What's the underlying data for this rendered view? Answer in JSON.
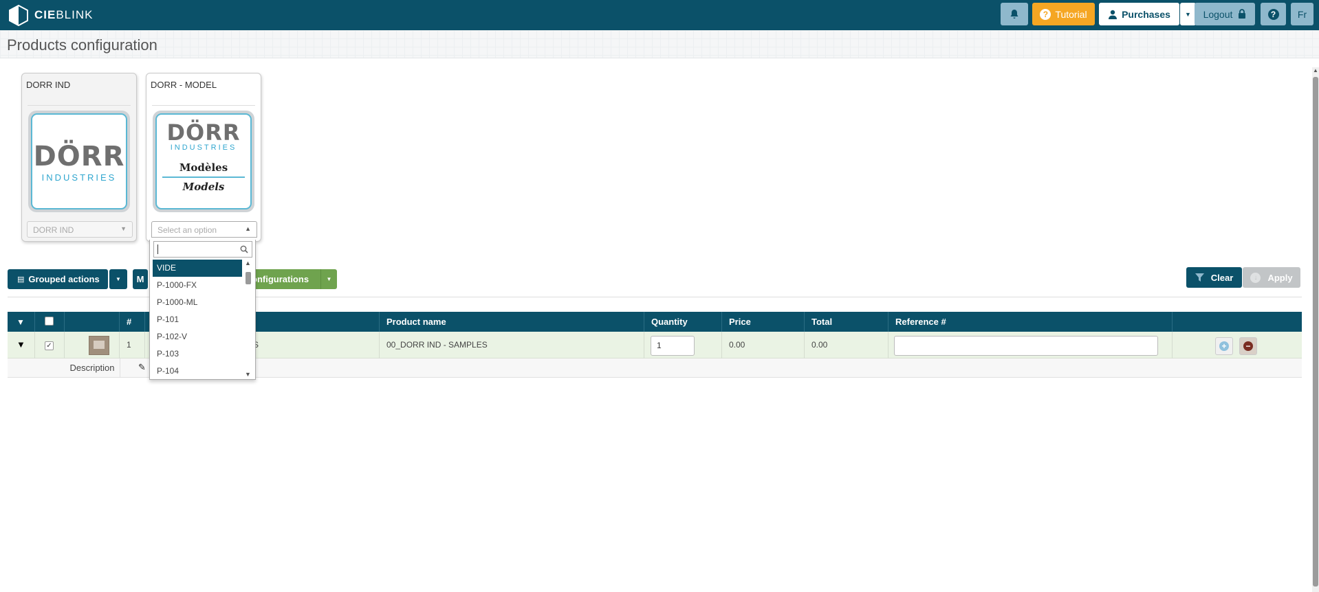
{
  "app": {
    "logo_prefix": "CIE",
    "logo_suffix": "BLINK"
  },
  "topbar": {
    "tutorial_label": "Tutorial",
    "purchases_label": "Purchases",
    "logout_label": "Logout",
    "lang_label": "Fr"
  },
  "page": {
    "title": "Products configuration"
  },
  "cards": [
    {
      "title": "DORR IND",
      "image": {
        "brand": "DÖRR",
        "sub": "INDUSTRIES"
      },
      "select_value": "DORR IND",
      "disabled": true
    },
    {
      "title": "DORR - MODEL",
      "image": {
        "brand": "DÖRR",
        "sub": "INDUSTRIES",
        "line1": "Modèles",
        "line2": "Models"
      },
      "select_placeholder": "Select an option",
      "disabled": false
    }
  ],
  "dropdown": {
    "search_value": "",
    "options": [
      "VIDE",
      "P-1000-FX",
      "P-1000-ML",
      "P-101",
      "P-102-V",
      "P-103",
      "P-104"
    ],
    "active_index": 0
  },
  "toolbar": {
    "grouped_actions_label": "Grouped actions",
    "m_label": "M",
    "configurations_label": "onfigurations",
    "clear_label": "Clear",
    "apply_label": "Apply"
  },
  "table": {
    "columns": [
      "",
      "",
      "",
      "#",
      "",
      "Product name",
      "Quantity",
      "Price",
      "Total",
      "Reference #",
      ""
    ],
    "rows": [
      {
        "number": "1",
        "code_tail": "S",
        "product_name": "00_DORR IND - SAMPLES",
        "quantity": "1",
        "price": "0.00",
        "total": "0.00",
        "reference": ""
      }
    ],
    "detail_label": "Description"
  },
  "colors": {
    "primary": "#0b5169",
    "accent": "#f5a623",
    "green": "#6fa34e"
  }
}
